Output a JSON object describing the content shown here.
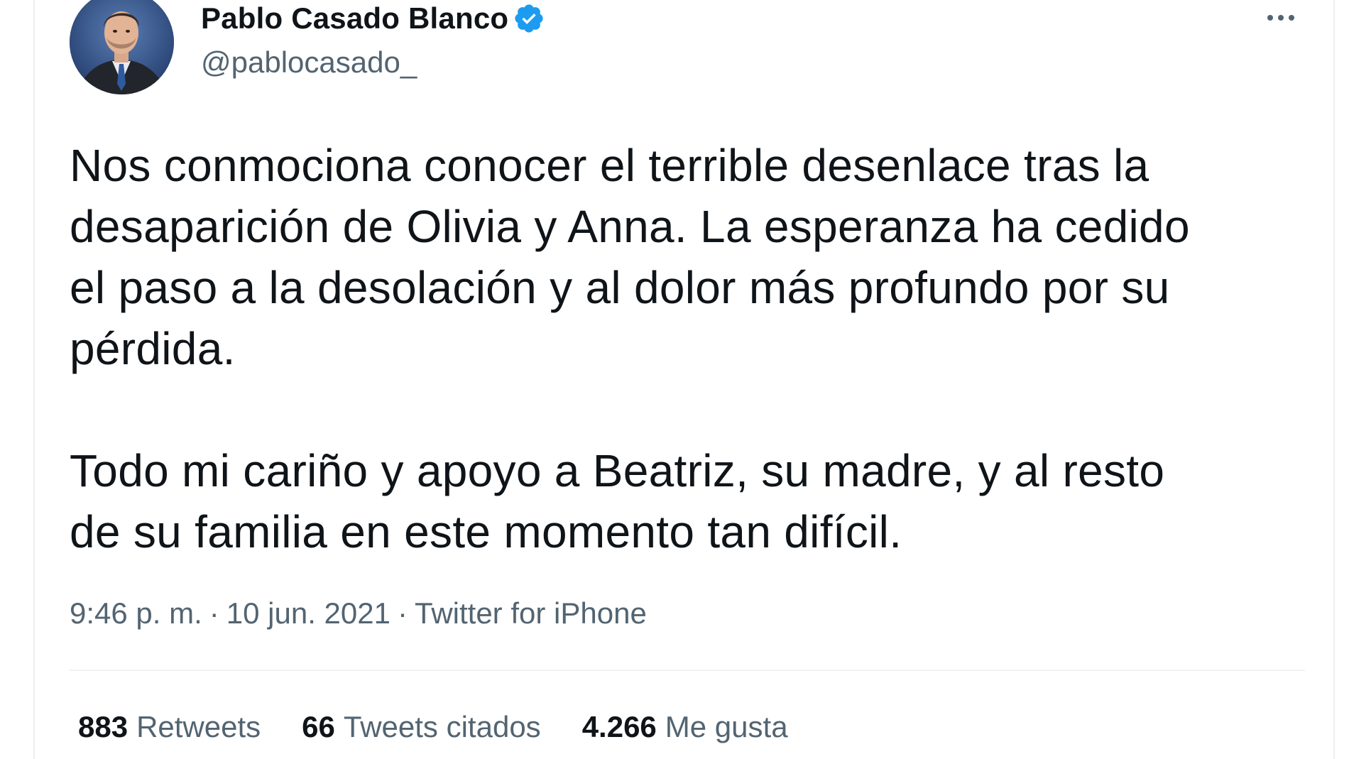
{
  "author": {
    "display_name": "Pablo Casado Blanco",
    "handle": "@pablocasado_",
    "verified": true,
    "verified_badge_color": "#1d9bf0"
  },
  "tweet": {
    "paragraphs": [
      "Nos conmociona conocer el terrible desenlace tras la\ndesaparición de Olivia y Anna. La esperanza ha cedido\nel paso a la desolación y al dolor más profundo por su\npérdida.",
      "Todo mi cariño y apoyo a Beatriz, su madre, y al resto\nde su familia en este momento tan difícil."
    ],
    "time": "9:46 p. m.",
    "separator": "·",
    "date": "10 jun. 2021",
    "source": "Twitter for iPhone"
  },
  "stats": {
    "retweets": {
      "count": "883",
      "label": "Retweets"
    },
    "quotes": {
      "count": "66",
      "label": "Tweets citados"
    },
    "likes": {
      "count": "4.266",
      "label": "Me gusta"
    }
  },
  "icons": {
    "more": "more-horizontal-icon",
    "verified": "verified-badge-icon"
  },
  "colors": {
    "text_primary": "#0f1419",
    "text_secondary": "#536471",
    "divider": "#eff3f4"
  }
}
